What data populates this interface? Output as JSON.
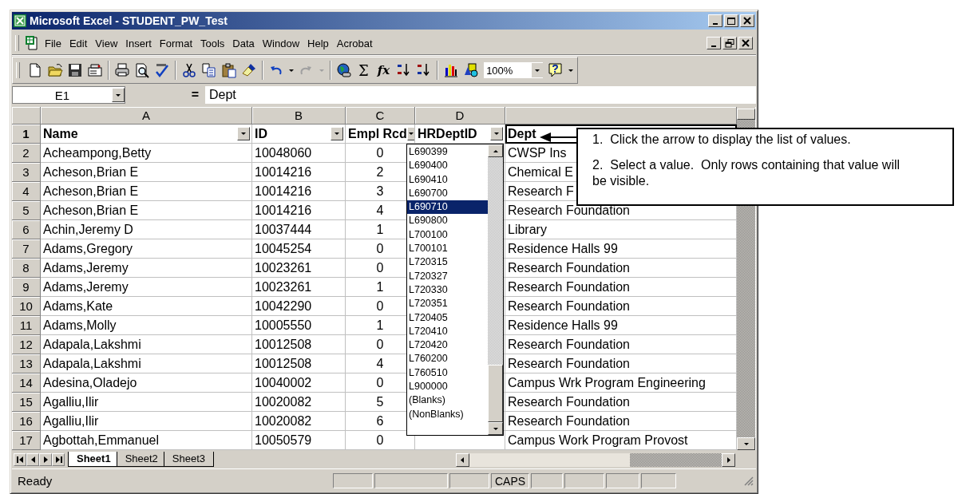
{
  "window": {
    "title": "Microsoft Excel - STUDENT_PW_Test"
  },
  "menu": [
    "File",
    "Edit",
    "View",
    "Insert",
    "Format",
    "Tools",
    "Data",
    "Window",
    "Help",
    "Acrobat"
  ],
  "toolbar": {
    "sum": "Σ",
    "function": "fx",
    "zoom": "100%"
  },
  "formula_bar": {
    "name_box": "E1",
    "equals": "=",
    "value": "Dept"
  },
  "columns": [
    "A",
    "B",
    "C",
    "D"
  ],
  "header_row": {
    "number": "1",
    "name": "Name",
    "id": "ID",
    "empl_rcd": "Empl Rcd",
    "hr_dept_id": "HRDeptID",
    "dept": "Dept"
  },
  "rows": [
    {
      "number": "2",
      "name": "Acheampong,Betty",
      "id": "10048060",
      "empl_rcd": "0",
      "dept": "CWSP Ins"
    },
    {
      "number": "3",
      "name": "Acheson,Brian E",
      "id": "10014216",
      "empl_rcd": "2",
      "dept": "Chemical E"
    },
    {
      "number": "4",
      "name": "Acheson,Brian E",
      "id": "10014216",
      "empl_rcd": "3",
      "dept": "Research F"
    },
    {
      "number": "5",
      "name": "Acheson,Brian E",
      "id": "10014216",
      "empl_rcd": "4",
      "dept": "Research Foundation"
    },
    {
      "number": "6",
      "name": "Achin,Jeremy D",
      "id": "10037444",
      "empl_rcd": "1",
      "dept": "Library"
    },
    {
      "number": "7",
      "name": "Adams,Gregory",
      "id": "10045254",
      "empl_rcd": "0",
      "dept": "Residence Halls 99"
    },
    {
      "number": "8",
      "name": "Adams,Jeremy",
      "id": "10023261",
      "empl_rcd": "0",
      "dept": "Research Foundation"
    },
    {
      "number": "9",
      "name": "Adams,Jeremy",
      "id": "10023261",
      "empl_rcd": "1",
      "dept": "Research Foundation"
    },
    {
      "number": "10",
      "name": "Adams,Kate",
      "id": "10042290",
      "empl_rcd": "0",
      "dept": "Research Foundation"
    },
    {
      "number": "11",
      "name": "Adams,Molly",
      "id": "10005550",
      "empl_rcd": "1",
      "dept": "Residence Halls 99"
    },
    {
      "number": "12",
      "name": "Adapala,Lakshmi",
      "id": "10012508",
      "empl_rcd": "0",
      "dept": "Research Foundation"
    },
    {
      "number": "13",
      "name": "Adapala,Lakshmi",
      "id": "10012508",
      "empl_rcd": "4",
      "dept": "Research Foundation"
    },
    {
      "number": "14",
      "name": "Adesina,Oladejo",
      "id": "10040002",
      "empl_rcd": "0",
      "dept": "Campus Wrk Program Engineering"
    },
    {
      "number": "15",
      "name": "Agalliu,Ilir",
      "id": "10020082",
      "empl_rcd": "5",
      "dept": "Research Foundation"
    },
    {
      "number": "16",
      "name": "Agalliu,Ilir",
      "id": "10020082",
      "empl_rcd": "6",
      "dept": "Research Foundation"
    },
    {
      "number": "17",
      "name": "Agbottah,Emmanuel",
      "id": "10050579",
      "empl_rcd": "0",
      "dept": "Campus Work Program Provost"
    }
  ],
  "filter_list": [
    {
      "label": "L690399",
      "selected": false
    },
    {
      "label": "L690400",
      "selected": false
    },
    {
      "label": "L690410",
      "selected": false
    },
    {
      "label": "L690700",
      "selected": false
    },
    {
      "label": "L690710",
      "selected": true
    },
    {
      "label": "L690800",
      "selected": false
    },
    {
      "label": "L700100",
      "selected": false
    },
    {
      "label": "L700101",
      "selected": false
    },
    {
      "label": "L720315",
      "selected": false
    },
    {
      "label": "L720327",
      "selected": false
    },
    {
      "label": "L720330",
      "selected": false
    },
    {
      "label": "L720351",
      "selected": false
    },
    {
      "label": "L720405",
      "selected": false
    },
    {
      "label": "L720410",
      "selected": false
    },
    {
      "label": "L720420",
      "selected": false
    },
    {
      "label": "L760200",
      "selected": false
    },
    {
      "label": "L760510",
      "selected": false
    },
    {
      "label": "L900000",
      "selected": false
    },
    {
      "label": "(Blanks)",
      "selected": false
    },
    {
      "label": "(NonBlanks)",
      "selected": false
    }
  ],
  "sheet_tabs": [
    {
      "label": "Sheet1",
      "selected": true
    },
    {
      "label": "Sheet2",
      "selected": false
    },
    {
      "label": "Sheet3",
      "selected": false
    }
  ],
  "status_bar": {
    "text": "Ready",
    "caps": "CAPS"
  },
  "callout": [
    "1.  Click the arrow to display the list of values.",
    "2.  Select a value.  Only rows containing that value will be visible."
  ]
}
